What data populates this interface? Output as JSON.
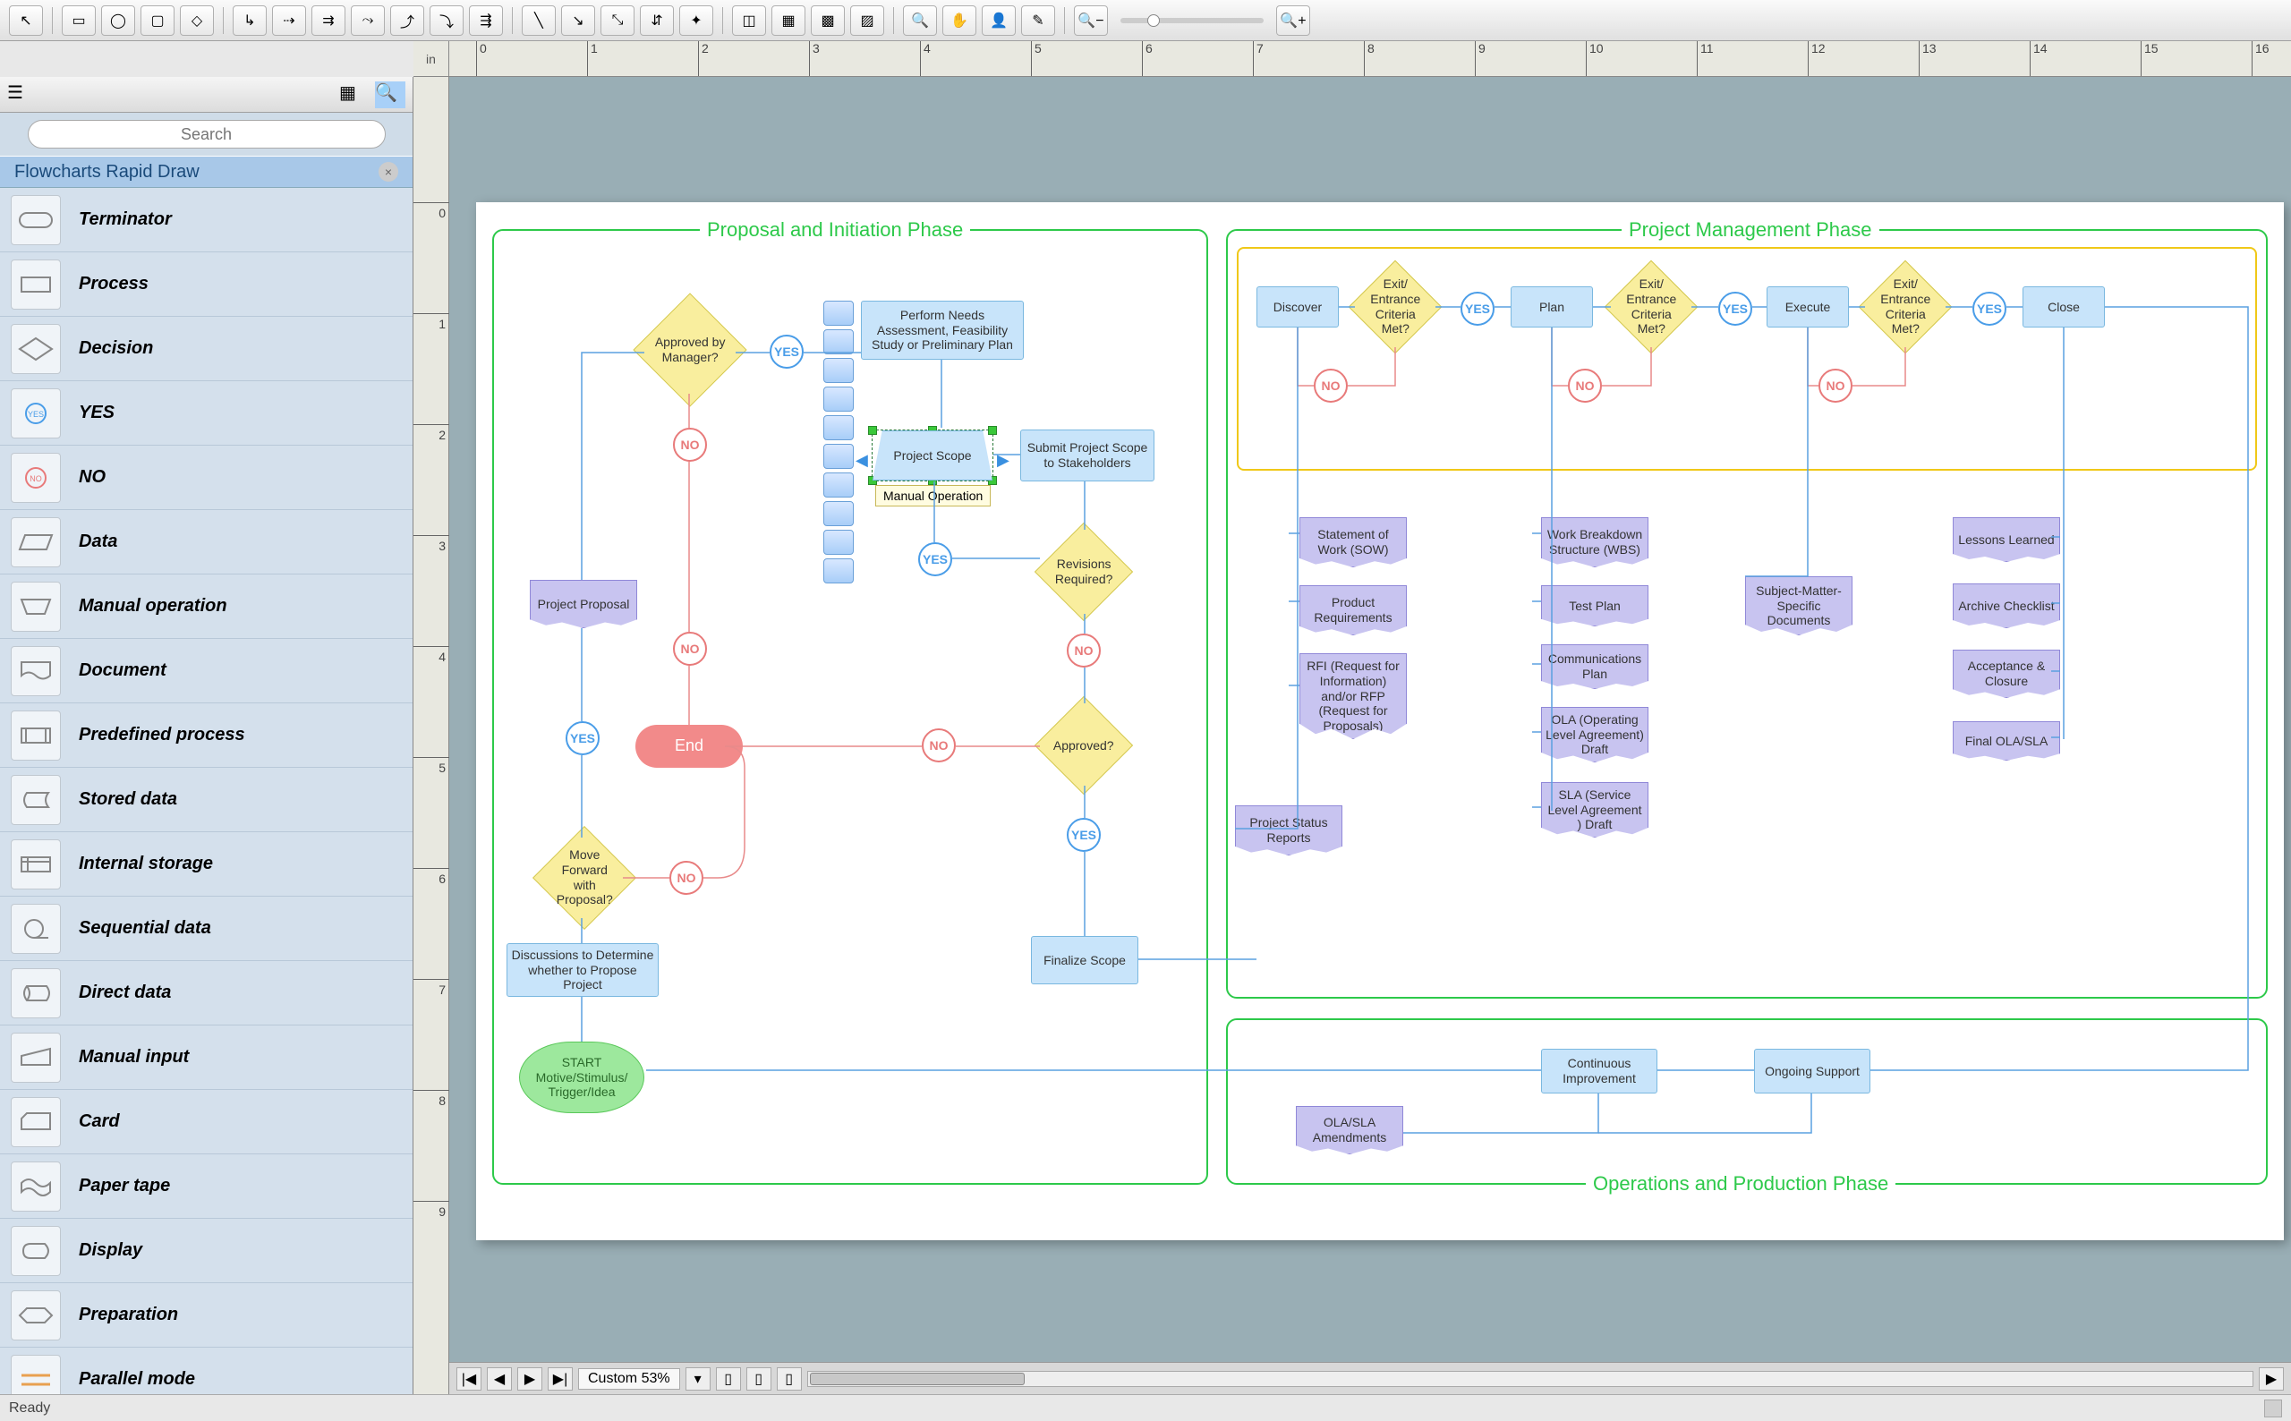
{
  "toolbar_icons": [
    "pointer",
    "rect",
    "ellipse",
    "rounded",
    "group1",
    "group2",
    "connector1",
    "connector2",
    "connector3",
    "connector4",
    "connector5",
    "line1",
    "line2",
    "line3",
    "line4",
    "line5",
    "shape1",
    "shape2",
    "shape3",
    "shape4",
    "zoom-in",
    "hand",
    "person",
    "eyedropper",
    "zoom-out-slider",
    "zoom-in-slider"
  ],
  "search": {
    "placeholder": "Search"
  },
  "ruler_unit": "in",
  "panel": {
    "title": "Flowcharts Rapid Draw"
  },
  "shapes": [
    {
      "label": "Terminator"
    },
    {
      "label": "Process"
    },
    {
      "label": "Decision"
    },
    {
      "label": "YES"
    },
    {
      "label": "NO"
    },
    {
      "label": "Data"
    },
    {
      "label": "Manual operation"
    },
    {
      "label": "Document"
    },
    {
      "label": "Predefined process"
    },
    {
      "label": "Stored data"
    },
    {
      "label": "Internal storage"
    },
    {
      "label": "Sequential data"
    },
    {
      "label": "Direct data"
    },
    {
      "label": "Manual input"
    },
    {
      "label": "Card"
    },
    {
      "label": "Paper tape"
    },
    {
      "label": "Display"
    },
    {
      "label": "Preparation"
    },
    {
      "label": "Parallel mode"
    }
  ],
  "phases": {
    "p1": "Proposal and Initiation Phase",
    "p2": "Project Management Phase",
    "p3": "Operations and Production Phase"
  },
  "tooltip": "Manual Operation",
  "selected_node_label": "Project Scope",
  "zoom_label": "Custom 53%",
  "status": "Ready",
  "yes": "YES",
  "no": "NO",
  "end": "End",
  "nodes": {
    "discover": "Discover",
    "plan": "Plan",
    "execute": "Execute",
    "close": "Close",
    "exit": "Exit/ Entrance Criteria Met?",
    "sow": "Statement of Work (SOW)",
    "prodreq": "Product Requirements",
    "rfi": "RFI (Request for Information) and/or RFP (Request for Proposals)",
    "psr": "Project Status Reports",
    "wbs": "Work Breakdown Structure (WBS)",
    "testplan": "Test Plan",
    "commplan": "Communications Plan",
    "ola": "OLA (Operating Level Agreement) Draft",
    "sla": "SLA (Service Level Agreement ) Draft",
    "sme": "Subject-Matter-Specific Documents",
    "lessons": "Lessons Learned",
    "archive": "Archive Checklist",
    "accept": "Acceptance & Closure",
    "finalola": "Final OLA/SLA",
    "start": "START Motive/Stimulus/ Trigger/Idea",
    "discuss": "Discussions to Determine whether to Propose Project",
    "movefwd": "Move Forward with Proposal?",
    "projprop": "Project Proposal",
    "approvedmgr": "Approved by Manager?",
    "perform": "Perform Needs Assessment, Feasibility Study or Preliminary Plan",
    "submit": "Submit Project Scope to Stakeholders",
    "revisions": "Revisions Required?",
    "approved": "Approved?",
    "finalize": "Finalize Scope",
    "contimprov": "Continuous Improvement",
    "ongoing": "Ongoing Support",
    "olasla": "OLA/SLA Amendments"
  }
}
